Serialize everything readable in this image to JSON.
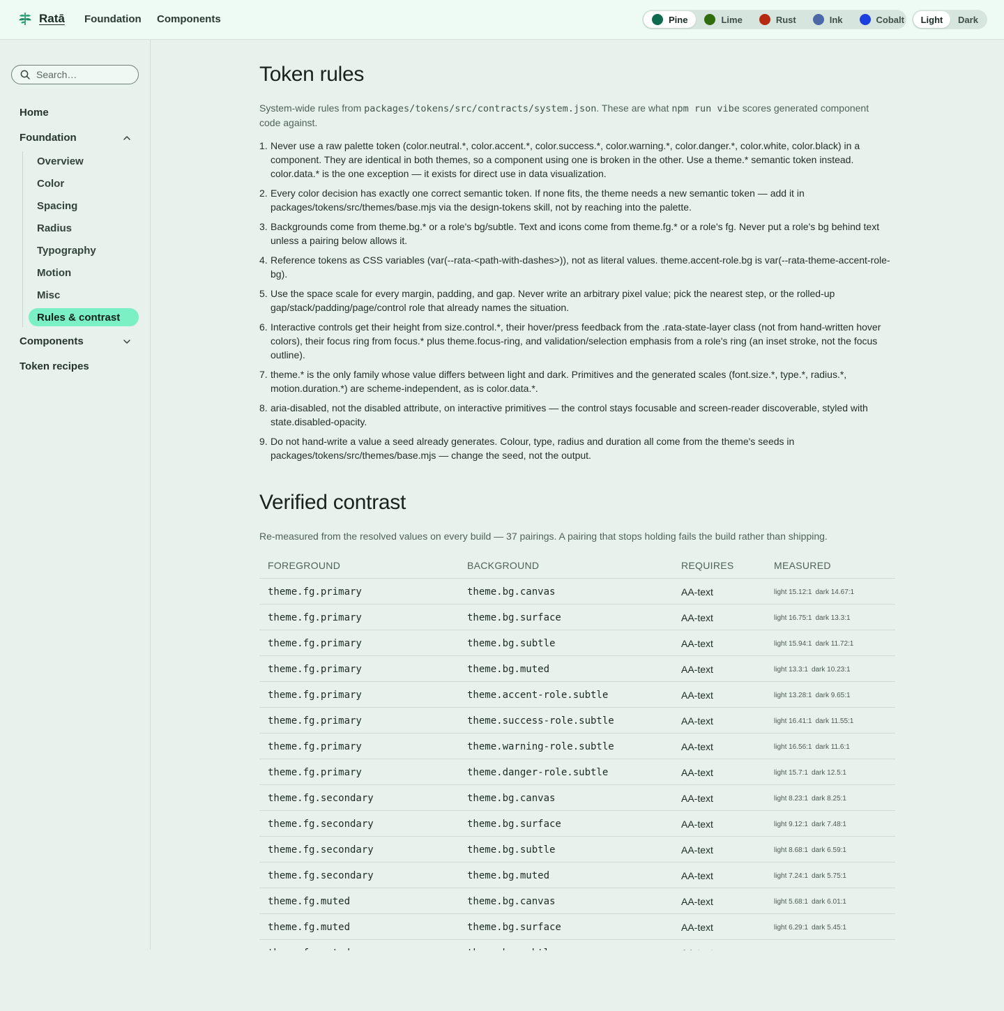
{
  "header": {
    "brand": "Ratā",
    "nav": [
      "Foundation",
      "Components"
    ],
    "palettes": [
      {
        "label": "Pine",
        "color": "#0e6b4f",
        "active": true
      },
      {
        "label": "Lime",
        "color": "#2f6d0e",
        "active": false
      },
      {
        "label": "Rust",
        "color": "#b72a12",
        "active": false
      },
      {
        "label": "Ink",
        "color": "#4a69a6",
        "active": false
      },
      {
        "label": "Cobalt",
        "color": "#1c40e0",
        "active": false
      }
    ],
    "schemes": {
      "light": "Light",
      "dark": "Dark",
      "active": "light"
    }
  },
  "sidebar": {
    "search_placeholder": "Search…",
    "home": "Home",
    "foundation": "Foundation",
    "foundation_items": [
      "Overview",
      "Color",
      "Spacing",
      "Radius",
      "Typography",
      "Motion",
      "Misc",
      "Rules & contrast"
    ],
    "active_item": "Rules & contrast",
    "components": "Components",
    "token_recipes": "Token recipes"
  },
  "rules_section": {
    "title": "Token rules",
    "intro_pre": "System-wide rules from ",
    "intro_path": "packages/tokens/src/contracts/system.json",
    "intro_mid": ". These are what ",
    "intro_cmd": "npm run vibe",
    "intro_post": " scores generated component code against.",
    "rules": [
      "Never use a raw palette token (color.neutral.*, color.accent.*, color.success.*, color.warning.*, color.danger.*, color.white, color.black) in a component. They are identical in both themes, so a component using one is broken in the other. Use a theme.* semantic token instead. color.data.* is the one exception — it exists for direct use in data visualization.",
      "Every color decision has exactly one correct semantic token. If none fits, the theme needs a new semantic token — add it in packages/tokens/src/themes/base.mjs via the design-tokens skill, not by reaching into the palette.",
      "Backgrounds come from theme.bg.* or a role's bg/subtle. Text and icons come from theme.fg.* or a role's fg. Never put a role's bg behind text unless a pairing below allows it.",
      "Reference tokens as CSS variables (var(--rata-<path-with-dashes>)), not as literal values. theme.accent-role.bg is var(--rata-theme-accent-role-bg).",
      "Use the space scale for every margin, padding, and gap. Never write an arbitrary pixel value; pick the nearest step, or the rolled-up gap/stack/padding/page/control role that already names the situation.",
      "Interactive controls get their height from size.control.*, their hover/press feedback from the .rata-state-layer class (not from hand-written hover colors), their focus ring from focus.* plus theme.focus-ring, and validation/selection emphasis from a role's ring (an inset stroke, not the focus outline).",
      "theme.* is the only family whose value differs between light and dark. Primitives and the generated scales (font.size.*, type.*, radius.*, motion.duration.*) are scheme-independent, as is color.data.*.",
      "aria-disabled, not the disabled attribute, on interactive primitives — the control stays focusable and screen-reader discoverable, styled with state.disabled-opacity.",
      "Do not hand-write a value a seed already generates. Colour, type, radius and duration all come from the theme's seeds in packages/tokens/src/themes/base.mjs — change the seed, not the output."
    ]
  },
  "contrast_section": {
    "title": "Verified contrast",
    "intro": "Re-measured from the resolved values on every build — 37 pairings. A pairing that stops holding fails the build rather than shipping.",
    "columns": [
      "FOREGROUND",
      "BACKGROUND",
      "REQUIRES",
      "MEASURED"
    ],
    "rows": [
      {
        "fg": "theme.fg.primary",
        "bg": "theme.bg.canvas",
        "req": "AA-text",
        "light": "light 15.12:1",
        "dark": "dark 14.67:1"
      },
      {
        "fg": "theme.fg.primary",
        "bg": "theme.bg.surface",
        "req": "AA-text",
        "light": "light 16.75:1",
        "dark": "dark 13.3:1"
      },
      {
        "fg": "theme.fg.primary",
        "bg": "theme.bg.subtle",
        "req": "AA-text",
        "light": "light 15.94:1",
        "dark": "dark 11.72:1"
      },
      {
        "fg": "theme.fg.primary",
        "bg": "theme.bg.muted",
        "req": "AA-text",
        "light": "light 13.3:1",
        "dark": "dark 10.23:1"
      },
      {
        "fg": "theme.fg.primary",
        "bg": "theme.accent-role.subtle",
        "req": "AA-text",
        "light": "light 13.28:1",
        "dark": "dark 9.65:1"
      },
      {
        "fg": "theme.fg.primary",
        "bg": "theme.success-role.subtle",
        "req": "AA-text",
        "light": "light 16.41:1",
        "dark": "dark 11.55:1"
      },
      {
        "fg": "theme.fg.primary",
        "bg": "theme.warning-role.subtle",
        "req": "AA-text",
        "light": "light 16.56:1",
        "dark": "dark 11.6:1"
      },
      {
        "fg": "theme.fg.primary",
        "bg": "theme.danger-role.subtle",
        "req": "AA-text",
        "light": "light 15.7:1",
        "dark": "dark 12.5:1"
      },
      {
        "fg": "theme.fg.secondary",
        "bg": "theme.bg.canvas",
        "req": "AA-text",
        "light": "light 8.23:1",
        "dark": "dark 8.25:1"
      },
      {
        "fg": "theme.fg.secondary",
        "bg": "theme.bg.surface",
        "req": "AA-text",
        "light": "light 9.12:1",
        "dark": "dark 7.48:1"
      },
      {
        "fg": "theme.fg.secondary",
        "bg": "theme.bg.subtle",
        "req": "AA-text",
        "light": "light 8.68:1",
        "dark": "dark 6.59:1"
      },
      {
        "fg": "theme.fg.secondary",
        "bg": "theme.bg.muted",
        "req": "AA-text",
        "light": "light 7.24:1",
        "dark": "dark 5.75:1"
      },
      {
        "fg": "theme.fg.muted",
        "bg": "theme.bg.canvas",
        "req": "AA-text",
        "light": "light 5.68:1",
        "dark": "dark 6.01:1"
      },
      {
        "fg": "theme.fg.muted",
        "bg": "theme.bg.surface",
        "req": "AA-text",
        "light": "light 6.29:1",
        "dark": "dark 5.45:1"
      },
      {
        "fg": "theme.fg.muted",
        "bg": "theme.bg.subtle",
        "req": "AA-text",
        "light": "",
        "dark": ""
      }
    ]
  }
}
